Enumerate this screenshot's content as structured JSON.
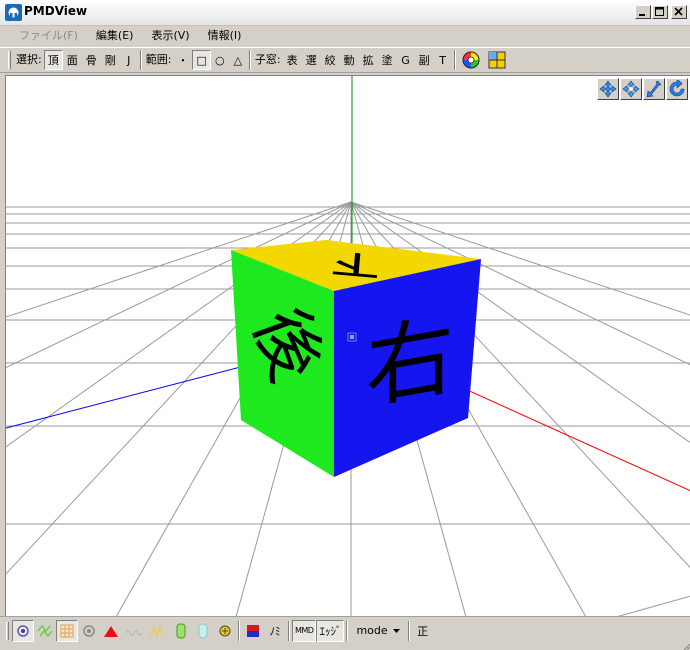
{
  "window": {
    "title": "PMDView"
  },
  "menu": [
    {
      "label": "ファイル(F)",
      "disabled": true
    },
    {
      "label": "編集(E)",
      "disabled": false
    },
    {
      "label": "表示(V)",
      "disabled": false
    },
    {
      "label": "情報(I)",
      "disabled": false
    }
  ],
  "toolbar": {
    "select_label": "選択:",
    "select_buttons": [
      "頂",
      "面",
      "骨",
      "剛",
      "J"
    ],
    "range_label": "範囲:",
    "range_buttons": [
      "・",
      "□",
      "○",
      "△"
    ],
    "child_label": "子窓:",
    "child_buttons": [
      "表",
      "選",
      "絞",
      "動",
      "拡",
      "塗",
      "G",
      "副",
      "T"
    ]
  },
  "cube": {
    "top_glyph": "下",
    "front_glyph": "右",
    "left_glyph": "後",
    "colors": {
      "top": "#f2d800",
      "front": "#1515f0",
      "left": "#1ee81e"
    }
  },
  "axes": {
    "x_color": "#ff0000",
    "y_color": "#008000",
    "z_color": "#0000ff"
  },
  "bottombar": {
    "mode_label": "mode",
    "mi_label": "ﾉﾐ",
    "edge_label": "ｴｯｼﾞ",
    "mmd_label": "MMD",
    "correct_label": "正"
  }
}
